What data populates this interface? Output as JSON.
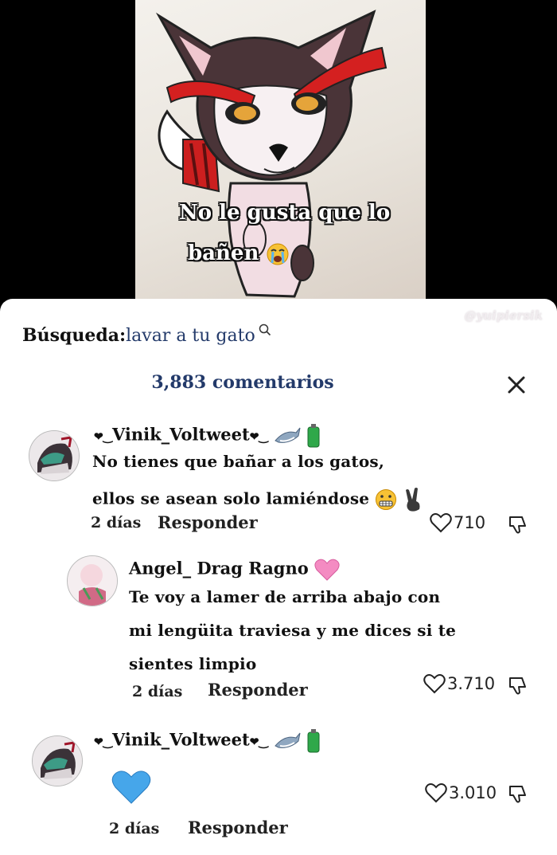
{
  "video": {
    "caption_line1": "No le gusta que lo",
    "caption_line2": "bañen",
    "caption_emoji": "crying-face",
    "watermark": "@yuipiersik"
  },
  "search": {
    "label": "Búsqueda:",
    "query": "lavar a tu gato",
    "icon": "search-icon"
  },
  "comments_header": {
    "count": "3,883 comentarios",
    "close_icon": "close-icon"
  },
  "comments": [
    {
      "username": "Vinik_Voltweet",
      "text_line1": "No tienes que bañar a los gatos,",
      "text_line2": "ellos se asean solo lamiéndose",
      "emojis": [
        "grimacing-face",
        "victory-hand"
      ],
      "name_emojis": [
        "shark",
        "battery"
      ],
      "time": "2 días",
      "reply_label": "Responder",
      "likes": "710"
    },
    {
      "username": "Angel_ Drag Ragno",
      "name_emojis": [
        "pink-heart"
      ],
      "text_line1": "Te voy a lamer de arriba abajo con",
      "text_line2": "mi lengüita traviesa y me dices si te",
      "text_line3": "sientes limpio",
      "time": "2 días",
      "reply_label": "Responder",
      "likes": "3.710"
    },
    {
      "username": "Vinik_Voltweet",
      "name_emojis": [
        "shark",
        "battery"
      ],
      "body_emoji": "blue-heart",
      "time": "2 días",
      "reply_label": "Responder",
      "likes": "3.010"
    }
  ],
  "colors": {
    "accent": "#233a6a",
    "caption_outline": "#111111"
  }
}
